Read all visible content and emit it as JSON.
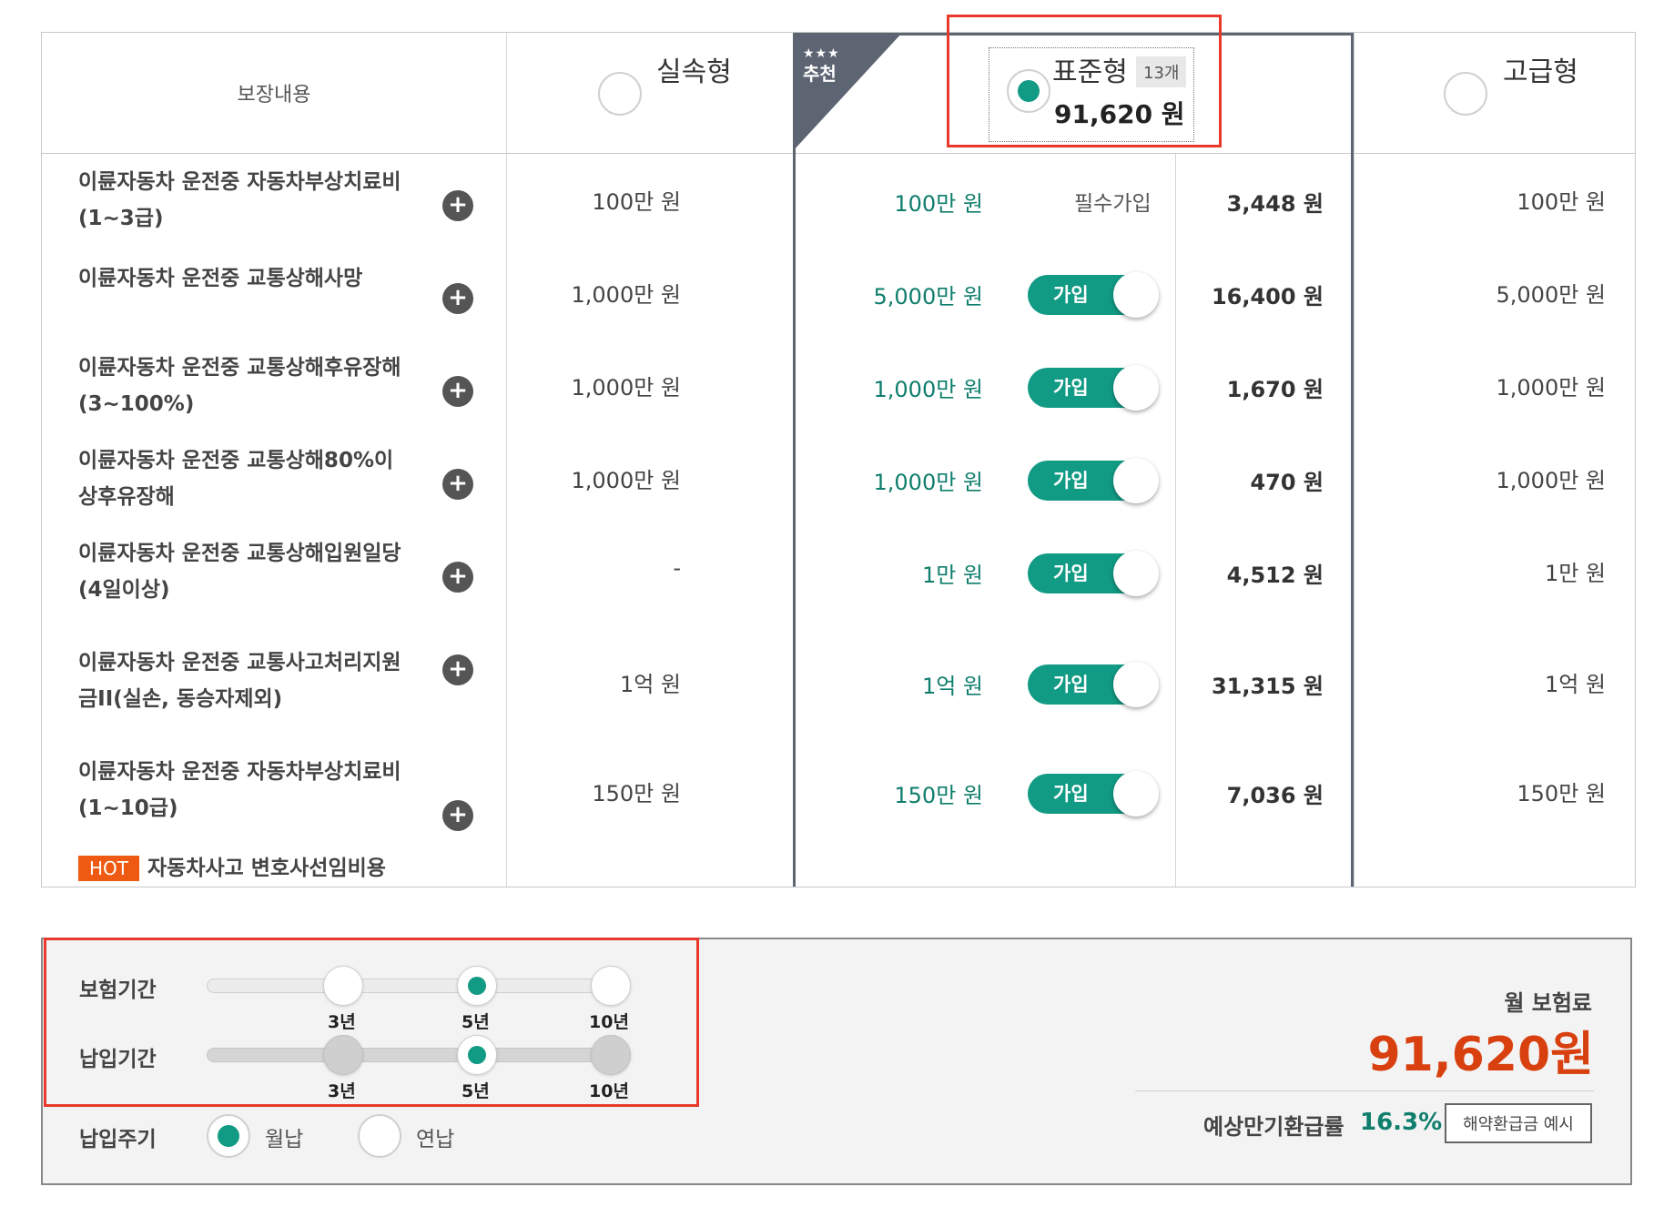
{
  "header": {
    "coverage_label": "보장내용",
    "plans": [
      {
        "name": "실속형",
        "selected": false
      },
      {
        "name": "표준형",
        "selected": true,
        "count_badge": "13개",
        "price": "91,620 원"
      },
      {
        "name": "고급형",
        "selected": false
      }
    ],
    "recommend": {
      "stars": "★★★",
      "label": "추천"
    }
  },
  "rows": [
    {
      "label": [
        "이륜자동차 운전중 자동차부상치료비",
        "(1~3급)"
      ],
      "basic": "100만 원",
      "standard": "100만 원",
      "join": "필수가입",
      "premium_amount": "3,448 원",
      "advanced": "100만 원"
    },
    {
      "label": [
        "이륜자동차 운전중 교통상해사망"
      ],
      "basic": "1,000만 원",
      "standard": "5,000만 원",
      "join": "가입",
      "premium_amount": "16,400 원",
      "advanced": "5,000만 원"
    },
    {
      "label": [
        "이륜자동차 운전중 교통상해후유장해",
        "(3~100%)"
      ],
      "basic": "1,000만 원",
      "standard": "1,000만 원",
      "join": "가입",
      "premium_amount": "1,670 원",
      "advanced": "1,000만 원"
    },
    {
      "label": [
        "이륜자동차 운전중 교통상해80%이",
        "상후유장해"
      ],
      "basic": "1,000만 원",
      "standard": "1,000만 원",
      "join": "가입",
      "premium_amount": "470 원",
      "advanced": "1,000만 원"
    },
    {
      "label": [
        "이륜자동차 운전중 교통상해입원일당",
        "(4일이상)"
      ],
      "basic": "-",
      "standard": "1만 원",
      "join": "가입",
      "premium_amount": "4,512 원",
      "advanced": "1만 원"
    },
    {
      "label": [
        "이륜자동차 운전중 교통사고처리지원",
        "금II(실손, 동승자제외)"
      ],
      "basic": "1억 원",
      "standard": "1억 원",
      "join": "가입",
      "premium_amount": "31,315 원",
      "advanced": "1억 원"
    },
    {
      "label": [
        "이륜자동차 운전중 자동차부상치료비",
        "(1~10급)"
      ],
      "basic": "150만 원",
      "standard": "150만 원",
      "join": "가입",
      "premium_amount": "7,036 원",
      "advanced": "150만 원"
    },
    {
      "hot": "HOT",
      "label": [
        "자동차사고 변호사선임비용"
      ]
    }
  ],
  "settings": {
    "insurance_period": {
      "label": "보험기간",
      "options": [
        "3년",
        "5년",
        "10년"
      ],
      "selected": "5년"
    },
    "payment_period": {
      "label": "납입기간",
      "options": [
        "3년",
        "5년",
        "10년"
      ],
      "selected": "5년"
    },
    "payment_cycle": {
      "label": "납입주기",
      "options": [
        "월납",
        "연납"
      ],
      "selected": "월납"
    }
  },
  "summary": {
    "monthly_label": "월 보험료",
    "monthly_value": "91,620원",
    "refund_label": "예상만기환급률",
    "refund_value": "16.3%",
    "refund_button": "해약환급금 예시"
  },
  "colors": {
    "accent": "#119a84",
    "price": "#d8400f",
    "hot": "#ee5a12",
    "highlight": "#e8392b",
    "frame": "#5d6472"
  }
}
